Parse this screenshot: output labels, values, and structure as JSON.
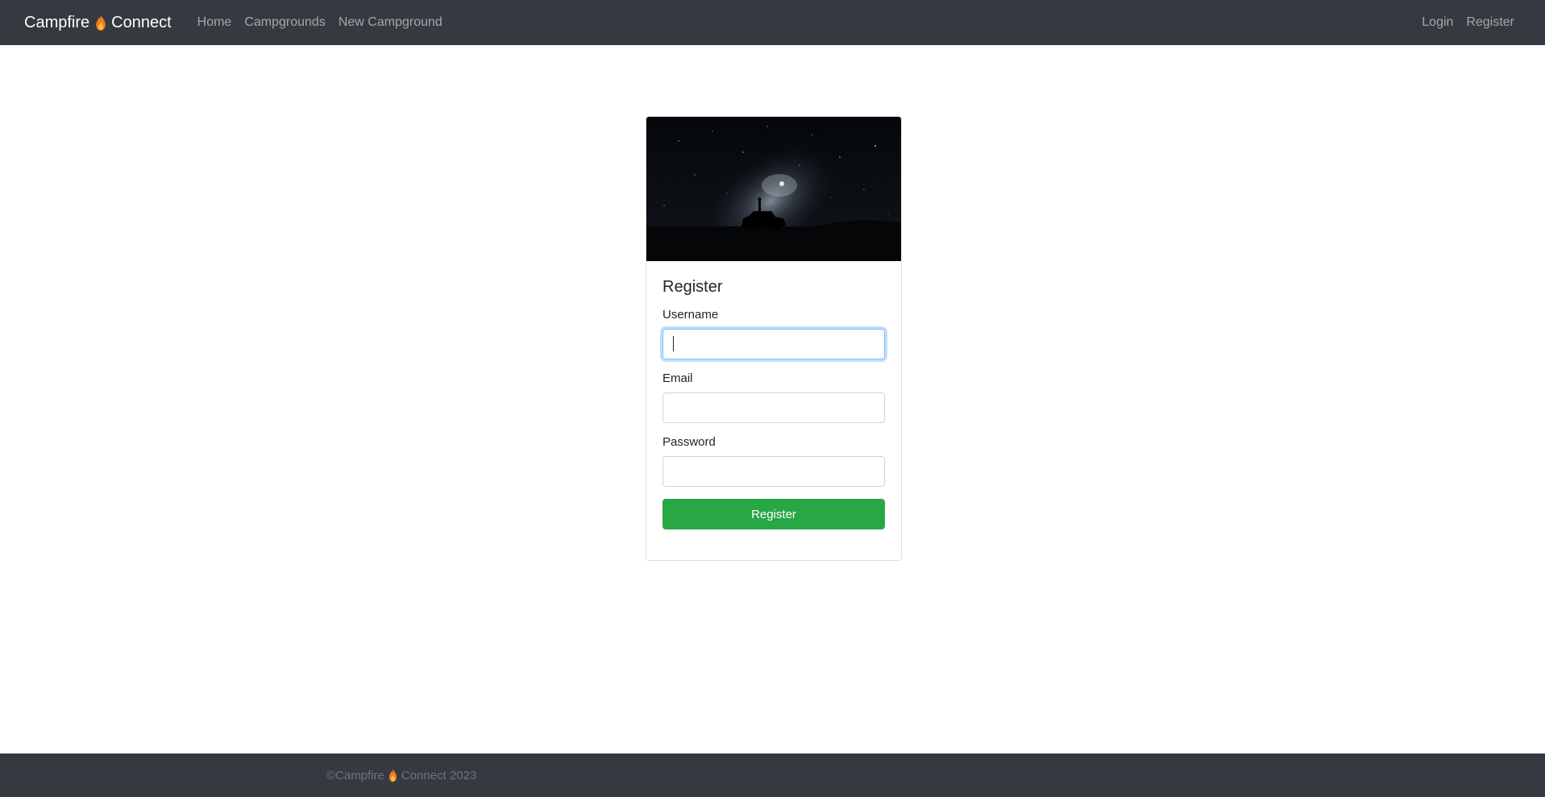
{
  "navbar": {
    "brand_left": "Campfire",
    "brand_right": "Connect",
    "brand_icon": "flame-icon",
    "links": [
      "Home",
      "Campgrounds",
      "New Campground"
    ],
    "right_links": [
      "Login",
      "Register"
    ],
    "bg_color": "#343a40"
  },
  "card": {
    "image": "night-sky-jeep-silhouette",
    "title": "Register",
    "fields": {
      "username_label": "Username",
      "username_value": "",
      "email_label": "Email",
      "email_value": "",
      "password_label": "Password",
      "password_value": ""
    },
    "submit_label": "Register",
    "submit_color": "#28a745"
  },
  "footer": {
    "copyright_prefix": "©Campfire",
    "copyright_suffix": "Connect 2023"
  }
}
